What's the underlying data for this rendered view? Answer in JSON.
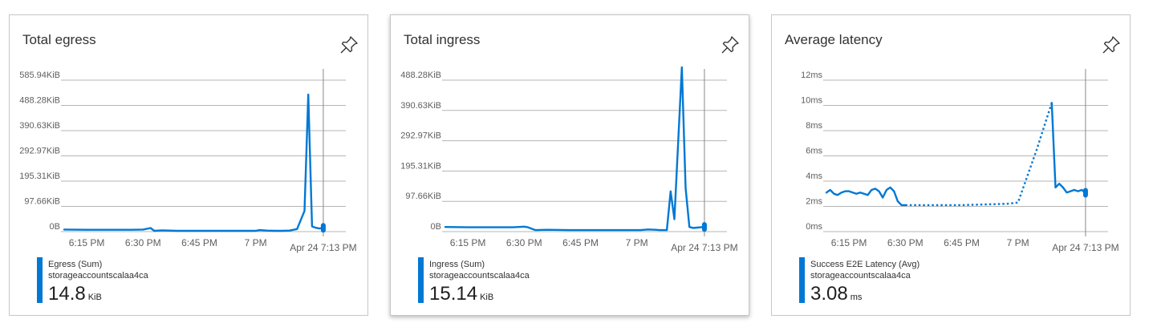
{
  "tiles": [
    {
      "title": "Total egress",
      "legend": {
        "name": "Egress (Sum)",
        "resource": "storageaccountscalaa4ca",
        "value": "14.8",
        "unit": "KiB"
      },
      "chart_data": {
        "type": "line",
        "title": "Total egress",
        "y_tick_labels": [
          "0B",
          "97.66KiB",
          "195.31KiB",
          "292.97KiB",
          "390.63KiB",
          "488.28KiB",
          "585.94KiB"
        ],
        "y_ticks": [
          0,
          97.66,
          195.31,
          292.97,
          390.63,
          488.28,
          585.94
        ],
        "ylim": [
          0,
          585.94
        ],
        "y_unit": "KiB",
        "x_tick_labels": [
          "6:15 PM",
          "6:30 PM",
          "6:45 PM",
          "7 PM"
        ],
        "x_ticks": [
          6,
          21,
          36,
          51
        ],
        "xlim": [
          0,
          75
        ],
        "cursor_label": "Apr 24 7:13 PM",
        "cursor_x": 69,
        "grid": true,
        "series": [
          {
            "name": "Egress (Sum)",
            "color": "#0078d4",
            "segments": [
              {
                "style": "solid",
                "x": [
                  0,
                  6,
                  12,
                  18,
                  21,
                  23,
                  24,
                  26,
                  30,
                  36,
                  42,
                  48,
                  51,
                  52,
                  54,
                  56,
                  58,
                  60,
                  62,
                  64,
                  65,
                  66,
                  67,
                  68,
                  69
                ],
                "y": [
                  8,
                  7,
                  7,
                  7,
                  8,
                  14,
                  3,
                  5,
                  3,
                  3,
                  3,
                  3,
                  3,
                  6,
                  4,
                  3,
                  3,
                  4,
                  10,
                  80,
                  530,
                  20,
                  15,
                  12,
                  14.8
                ]
              }
            ]
          }
        ]
      }
    },
    {
      "title": "Total ingress",
      "legend": {
        "name": "Ingress (Sum)",
        "resource": "storageaccountscalaa4ca",
        "value": "15.14",
        "unit": "KiB"
      },
      "chart_data": {
        "type": "line",
        "title": "Total ingress",
        "y_tick_labels": [
          "0B",
          "97.66KiB",
          "195.31KiB",
          "292.97KiB",
          "390.63KiB",
          "488.28KiB"
        ],
        "y_ticks": [
          0,
          97.66,
          195.31,
          292.97,
          390.63,
          488.28
        ],
        "ylim": [
          0,
          488.28
        ],
        "y_unit": "KiB",
        "x_tick_labels": [
          "6:15 PM",
          "6:30 PM",
          "6:45 PM",
          "7 PM"
        ],
        "x_ticks": [
          6,
          21,
          36,
          51
        ],
        "xlim": [
          0,
          75
        ],
        "cursor_label": "Apr 24 7:13 PM",
        "cursor_x": 69,
        "grid": true,
        "series": [
          {
            "name": "Ingress (Sum)",
            "color": "#0078d4",
            "segments": [
              {
                "style": "solid",
                "x": [
                  0,
                  6,
                  12,
                  18,
                  21,
                  22,
                  24,
                  27,
                  33,
                  39,
                  45,
                  50,
                  52,
                  54,
                  56,
                  57,
                  58,
                  59,
                  60,
                  61,
                  63,
                  64,
                  65,
                  66,
                  67,
                  68,
                  69
                ],
                "y": [
                  15,
                  14,
                  14,
                  14,
                  16,
                  14,
                  5,
                  6,
                  5,
                  5,
                  5,
                  5,
                  5,
                  7,
                  6,
                  5,
                  5,
                  5,
                  130,
                  40,
                  530,
                  140,
                  15,
                  12,
                  13,
                  14,
                  15.14
                ]
              }
            ]
          }
        ]
      }
    },
    {
      "title": "Average latency",
      "legend": {
        "name": "Success E2E Latency (Avg)",
        "resource": "storageaccountscalaa4ca",
        "value": "3.08",
        "unit": "ms"
      },
      "chart_data": {
        "type": "line",
        "title": "Average latency",
        "y_tick_labels": [
          "0ms",
          "2ms",
          "4ms",
          "6ms",
          "8ms",
          "10ms",
          "12ms"
        ],
        "y_ticks": [
          0,
          2,
          4,
          6,
          8,
          10,
          12
        ],
        "ylim": [
          0,
          12
        ],
        "y_unit": "ms",
        "x_tick_labels": [
          "6:15 PM",
          "6:30 PM",
          "6:45 PM",
          "7 PM"
        ],
        "x_ticks": [
          6,
          21,
          36,
          51
        ],
        "xlim": [
          0,
          75
        ],
        "cursor_label": "Apr 24 7:13 PM",
        "cursor_x": 69,
        "grid": true,
        "series": [
          {
            "name": "Success E2E Latency (Avg)",
            "color": "#0078d4",
            "segments": [
              {
                "style": "solid",
                "x": [
                  0,
                  1,
                  2,
                  3,
                  4,
                  5,
                  6,
                  7,
                  8,
                  9,
                  10,
                  11,
                  12,
                  13,
                  14,
                  15,
                  16,
                  17,
                  18,
                  19,
                  20,
                  21
                ],
                "y": [
                  3.1,
                  3.3,
                  3.0,
                  2.9,
                  3.1,
                  3.2,
                  3.2,
                  3.1,
                  3.0,
                  3.1,
                  3.0,
                  2.9,
                  3.3,
                  3.4,
                  3.2,
                  2.7,
                  3.3,
                  3.5,
                  3.2,
                  2.4,
                  2.1,
                  2.1
                ]
              },
              {
                "style": "dotted",
                "x": [
                  21,
                  36,
                  48,
                  51,
                  56,
                  60
                ],
                "y": [
                  2.1,
                  2.1,
                  2.2,
                  2.3,
                  6.5,
                  10.2
                ]
              },
              {
                "style": "solid",
                "x": [
                  60,
                  61,
                  62,
                  63,
                  64,
                  65,
                  66,
                  67,
                  68,
                  69
                ],
                "y": [
                  10.2,
                  3.5,
                  3.8,
                  3.5,
                  3.1,
                  3.2,
                  3.3,
                  3.2,
                  3.3,
                  3.08
                ]
              }
            ]
          }
        ]
      }
    }
  ]
}
